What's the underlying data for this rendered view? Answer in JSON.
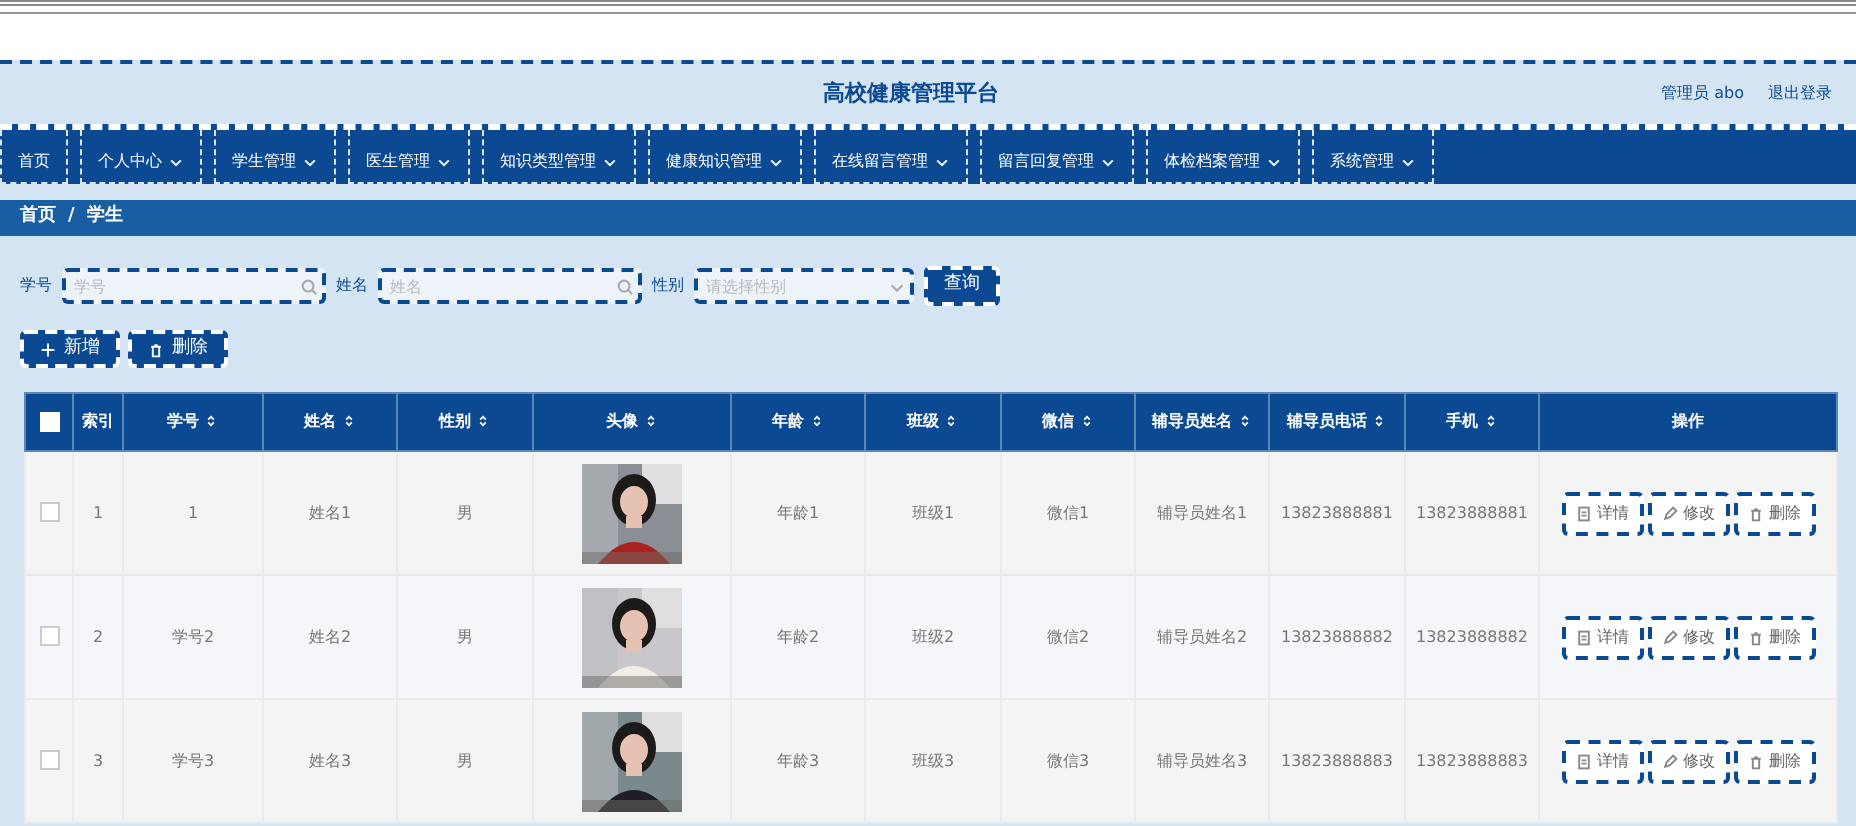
{
  "header": {
    "title": "高校健康管理平台",
    "user": "管理员 abo",
    "logout": "退出登录"
  },
  "nav": [
    {
      "label": "首页",
      "dropdown": false
    },
    {
      "label": "个人中心",
      "dropdown": true
    },
    {
      "label": "学生管理",
      "dropdown": true
    },
    {
      "label": "医生管理",
      "dropdown": true
    },
    {
      "label": "知识类型管理",
      "dropdown": true
    },
    {
      "label": "健康知识管理",
      "dropdown": true
    },
    {
      "label": "在线留言管理",
      "dropdown": true
    },
    {
      "label": "留言回复管理",
      "dropdown": true
    },
    {
      "label": "体检档案管理",
      "dropdown": true
    },
    {
      "label": "系统管理",
      "dropdown": true
    }
  ],
  "breadcrumb": {
    "items": [
      "首页",
      "学生"
    ],
    "separator": "/"
  },
  "search": {
    "fields": [
      {
        "label": "学号",
        "placeholder": "学号",
        "kind": "text"
      },
      {
        "label": "姓名",
        "placeholder": "姓名",
        "kind": "text"
      },
      {
        "label": "性别",
        "placeholder": "请选择性别",
        "kind": "select"
      }
    ],
    "button": "查询"
  },
  "actions": [
    {
      "label": "新增",
      "kind": "add"
    },
    {
      "label": "删除",
      "kind": "delete"
    }
  ],
  "table": {
    "header_checked": false,
    "columns": [
      {
        "label": "索引",
        "kind": "text",
        "sortable": false
      },
      {
        "label": "学号",
        "kind": "text",
        "sortable": true
      },
      {
        "label": "姓名",
        "kind": "text",
        "sortable": true
      },
      {
        "label": "性别",
        "kind": "text",
        "sortable": true
      },
      {
        "label": "头像",
        "kind": "picture",
        "sortable": true
      },
      {
        "label": "年龄",
        "kind": "text",
        "sortable": true
      },
      {
        "label": "班级",
        "kind": "text",
        "sortable": true
      },
      {
        "label": "微信",
        "kind": "text",
        "sortable": true
      },
      {
        "label": "辅导员姓名",
        "kind": "text",
        "sortable": true
      },
      {
        "label": "辅导员电话",
        "kind": "text",
        "sortable": true
      },
      {
        "label": "手机",
        "kind": "text",
        "sortable": true
      },
      {
        "label": "操作",
        "kind": "actions",
        "sortable": false
      }
    ],
    "rows": [
      {
        "checked": false,
        "cells": [
          "1",
          "1",
          "姓名1",
          "男",
          {
            "kind": "picture"
          },
          "年龄1",
          "班级1",
          "微信1",
          "辅导员姓名1",
          "13823888881",
          "13823888881",
          [
            {
              "label": "详情",
              "kind": "detail"
            },
            {
              "label": "修改",
              "kind": "edit"
            },
            {
              "label": "删除",
              "kind": "delete"
            }
          ]
        ]
      },
      {
        "checked": false,
        "cells": [
          "2",
          "学号2",
          "姓名2",
          "男",
          {
            "kind": "picture"
          },
          "年龄2",
          "班级2",
          "微信2",
          "辅导员姓名2",
          "13823888882",
          "13823888882",
          [
            {
              "label": "详情",
              "kind": "detail"
            },
            {
              "label": "修改",
              "kind": "edit"
            },
            {
              "label": "删除",
              "kind": "delete"
            }
          ]
        ]
      },
      {
        "checked": false,
        "cells": [
          "3",
          "学号3",
          "姓名3",
          "男",
          {
            "kind": "picture"
          },
          "年龄3",
          "班级3",
          "微信3",
          "辅导员姓名3",
          "13823888883",
          "13823888883",
          [
            {
              "label": "详情",
              "kind": "detail"
            },
            {
              "label": "修改",
              "kind": "edit"
            },
            {
              "label": "删除",
              "kind": "delete"
            }
          ]
        ]
      }
    ]
  }
}
